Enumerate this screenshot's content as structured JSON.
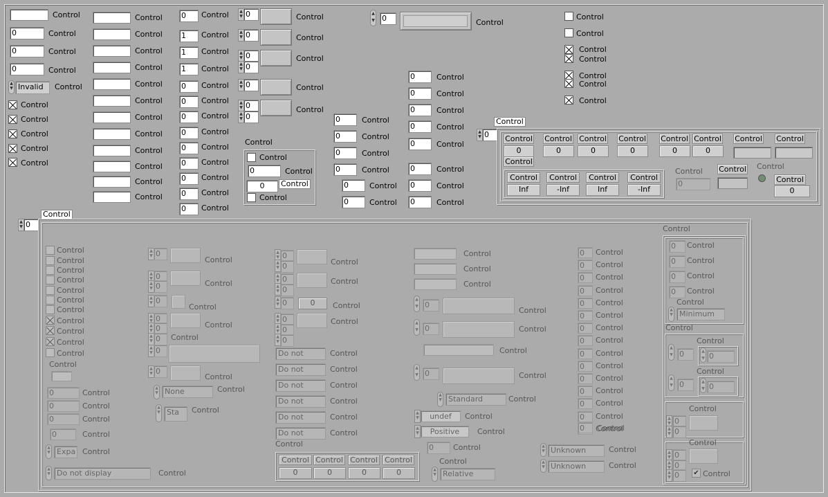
{
  "label": "Control",
  "labels": {
    "invalid": "Invalid",
    "inf": "Inf",
    "neg_inf": "-Inf",
    "zero": "0",
    "one": "1",
    "none": "None",
    "sta": "Sta",
    "do_not": "Do not",
    "standard": "Standard",
    "undef": "undef",
    "positive": "Positive",
    "relative": "Relative",
    "unknown": "Unknown",
    "minimum": "Minimum",
    "expa": "Expa",
    "do_not_display": "Do not display",
    "checkmark": "✔"
  },
  "checkbox_states": {
    "top_left": [
      true,
      true,
      true,
      true,
      true
    ],
    "top_right": [
      false,
      false,
      true,
      true,
      true,
      true,
      true
    ],
    "top_middle": [
      false,
      false
    ],
    "lower_left": [
      false,
      false,
      false,
      false,
      false,
      false,
      false,
      true,
      true,
      true,
      false
    ]
  },
  "colors": {
    "panel_bg": "#ababab",
    "field_bg": "#ffffff",
    "disabled_field_bg": "#b4b4b4",
    "led_green": "#6f8f6f"
  }
}
